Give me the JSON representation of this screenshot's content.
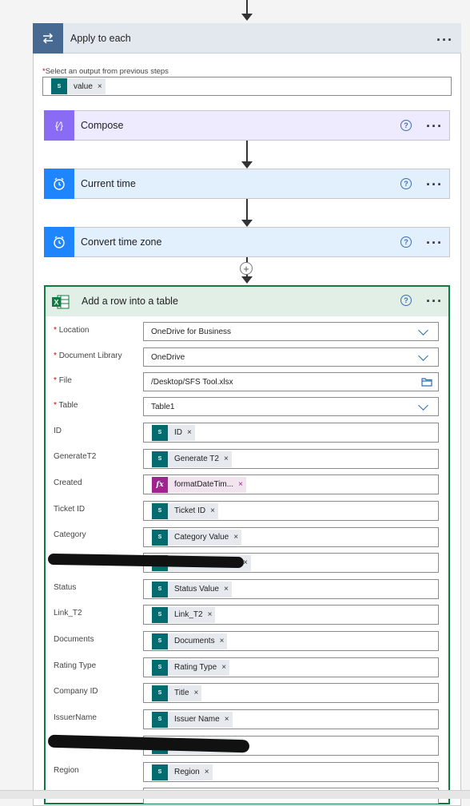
{
  "apply_to_each": {
    "title": "Apply to each",
    "select_label": "Select an output from previous steps",
    "token": "value"
  },
  "compose": {
    "title": "Compose"
  },
  "current_time": {
    "title": "Current time"
  },
  "convert_time_zone": {
    "title": "Convert time zone"
  },
  "add_row": {
    "title": "Add a row into a table",
    "fields": {
      "location": {
        "label": "Location",
        "value": "OneDrive for Business"
      },
      "document_library": {
        "label": "Document Library",
        "value": "OneDrive"
      },
      "file": {
        "label": "File",
        "value": "/Desktop/SFS Tool.xlsx"
      },
      "table": {
        "label": "Table",
        "value": "Table1"
      },
      "id": {
        "label": "ID",
        "token": "ID"
      },
      "generate_t2": {
        "label": "GenerateT2",
        "token": "Generate T2"
      },
      "created": {
        "label": "Created",
        "token": "formatDateTim..."
      },
      "ticket_id": {
        "label": "Ticket ID",
        "token": "Ticket ID"
      },
      "category": {
        "label": "Category",
        "token": "Category Value"
      },
      "status": {
        "label": "Status",
        "token": "Status Value"
      },
      "link_t2": {
        "label": "Link_T2",
        "token": "Link_T2"
      },
      "documents": {
        "label": "Documents",
        "token": "Documents"
      },
      "rating_type": {
        "label": "Rating Type",
        "token": "Rating Type"
      },
      "company_id": {
        "label": "Company ID",
        "token": "Title"
      },
      "issuer_name": {
        "label": "IssuerName",
        "token": "Issuer Name"
      },
      "region": {
        "label": "Region",
        "token": "Region"
      }
    }
  },
  "colors": {
    "compose_accent": "#8a6cf4",
    "schedule_accent": "#1f85ff",
    "excel_accent": "#107c41",
    "sharepoint_token": "#036c70",
    "expression_token": "#a4228f"
  }
}
